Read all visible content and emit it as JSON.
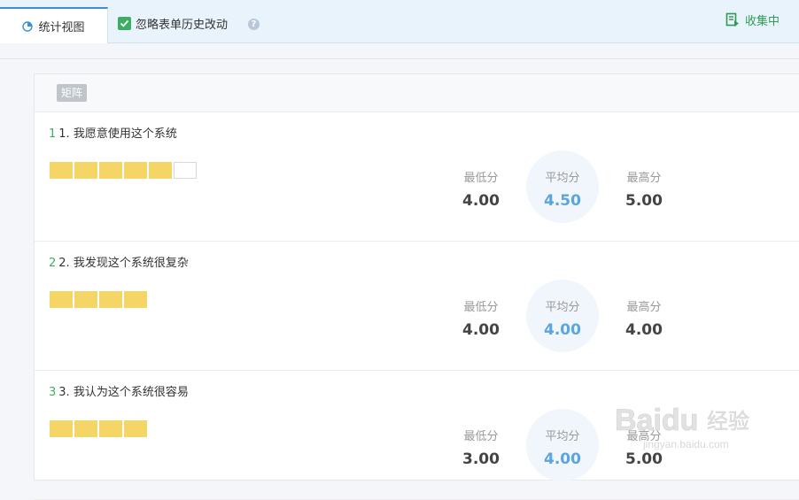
{
  "tabs": {
    "stats_view": "统计视图"
  },
  "toolbar": {
    "ignore_history": "忽略表单历史改动",
    "collecting": "收集中"
  },
  "panel": {
    "badge": "矩阵"
  },
  "colors": {
    "accent": "#3d8fd6",
    "green": "#3cae63",
    "bar_fill": "#f5d565",
    "avg_blue": "#5aa5e0"
  },
  "stat_labels": {
    "min": "最低分",
    "avg": "平均分",
    "max": "最高分"
  },
  "questions": [
    {
      "num": "1",
      "title": "1. 我愿意使用这个系统",
      "bars_filled": 5,
      "bars_total": 6,
      "min": "4.00",
      "avg": "4.50",
      "max": "5.00"
    },
    {
      "num": "2",
      "title": "2. 我发现这个系统很复杂",
      "bars_filled": 4,
      "bars_total": 4,
      "min": "4.00",
      "avg": "4.00",
      "max": "4.00"
    },
    {
      "num": "3",
      "title": "3. 我认为这个系统很容易",
      "bars_filled": 4,
      "bars_total": 4,
      "min": "3.00",
      "avg": "4.00",
      "max": "5.00"
    }
  ],
  "watermark": {
    "brand": "Baidu",
    "text": "经验",
    "url": "jingyan.baidu.com"
  }
}
